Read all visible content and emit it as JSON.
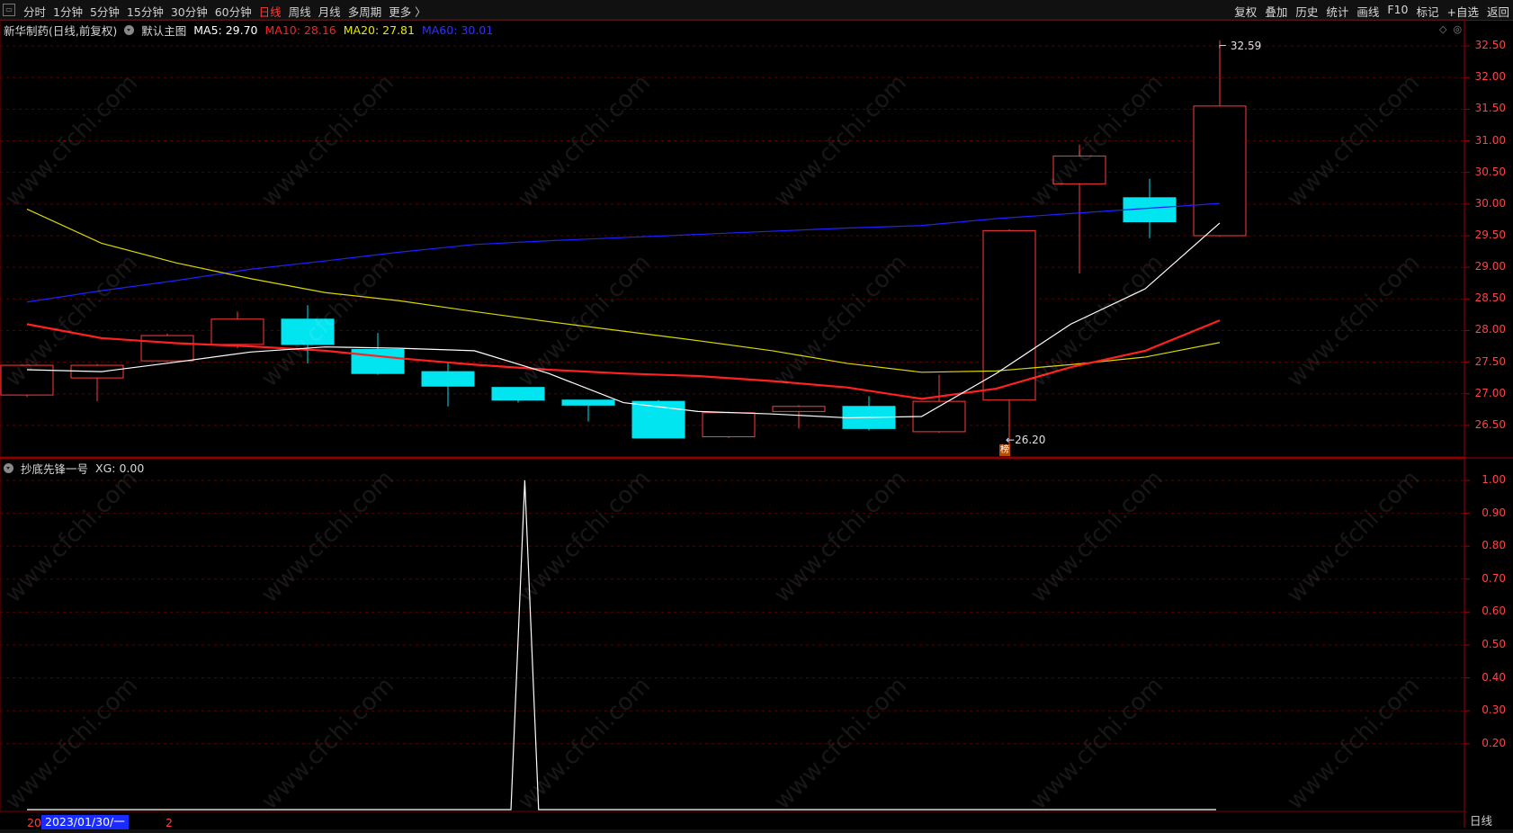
{
  "topbar": {
    "periods": [
      "分时",
      "1分钟",
      "5分钟",
      "15分钟",
      "30分钟",
      "60分钟",
      "日线",
      "周线",
      "月线",
      "多周期",
      "更多 〉"
    ],
    "active_period": "日线",
    "tools": [
      "复权",
      "叠加",
      "历史",
      "统计",
      "画线",
      "F10",
      "标记",
      "+自选",
      "返回"
    ]
  },
  "main_legend": {
    "title": "新华制药(日线,前复权)",
    "indicator": "默认主图",
    "ma5": "MA5: 29.70",
    "ma10": "MA10: 28.16",
    "ma20": "MA20: 27.81",
    "ma60": "MA60: 30.01"
  },
  "sub_legend": {
    "title": "抄底先锋一号",
    "xg": "XG: 0.00"
  },
  "main_axis": [
    "32.50",
    "32.00",
    "31.50",
    "31.00",
    "30.50",
    "30.00",
    "29.50",
    "29.00",
    "28.50",
    "28.00",
    "27.50",
    "27.00",
    "26.50"
  ],
  "sub_axis": [
    "1.00",
    "0.90",
    "0.80",
    "0.70",
    "0.60",
    "0.50",
    "0.40",
    "0.30",
    "0.20"
  ],
  "annotations": {
    "high_label": "32.59",
    "low_label": "26.20",
    "bang": "榜"
  },
  "bottom": {
    "date_prefix": "20",
    "date": "2023/01/30/一",
    "date_suffix": "2",
    "rili": "日线"
  },
  "watermark": "www.cfchi.com",
  "colors": {
    "up": "#ff3b3b",
    "down": "#00e5f0",
    "ma5": "#ffffff",
    "ma10": "#ff2020",
    "ma20": "#d8d800",
    "ma60": "#2020ff"
  },
  "chart_data": {
    "type": "candlestick",
    "candles": [
      {
        "open": 26.98,
        "close": 27.45,
        "high": 27.47,
        "low": 26.95
      },
      {
        "open": 27.25,
        "close": 27.45,
        "high": 27.47,
        "low": 26.88
      },
      {
        "open": 27.52,
        "close": 27.92,
        "high": 27.95,
        "low": 27.5
      },
      {
        "open": 27.78,
        "close": 28.18,
        "high": 28.3,
        "low": 27.72
      },
      {
        "open": 28.18,
        "close": 27.78,
        "high": 28.4,
        "low": 27.48
      },
      {
        "open": 27.7,
        "close": 27.32,
        "high": 27.96,
        "low": 27.3
      },
      {
        "open": 27.35,
        "close": 27.12,
        "high": 27.5,
        "low": 26.8
      },
      {
        "open": 27.1,
        "close": 26.9,
        "high": 27.1,
        "low": 26.86
      },
      {
        "open": 26.9,
        "close": 26.82,
        "high": 26.9,
        "low": 26.56
      },
      {
        "open": 26.88,
        "close": 26.3,
        "high": 26.9,
        "low": 26.3
      },
      {
        "open": 26.32,
        "close": 26.7,
        "high": 26.72,
        "low": 26.3
      },
      {
        "open": 26.72,
        "close": 26.8,
        "high": 26.82,
        "low": 26.45
      },
      {
        "open": 26.8,
        "close": 26.45,
        "high": 26.96,
        "low": 26.42
      },
      {
        "open": 26.4,
        "close": 26.88,
        "high": 27.3,
        "low": 26.38
      },
      {
        "open": 26.9,
        "close": 29.58,
        "high": 29.6,
        "low": 26.2
      },
      {
        "open": 30.32,
        "close": 30.76,
        "high": 30.94,
        "low": 28.9
      },
      {
        "open": 30.1,
        "close": 29.72,
        "high": 30.4,
        "low": 29.46
      },
      {
        "open": 29.5,
        "close": 31.55,
        "high": 32.59,
        "low": 29.48
      }
    ],
    "ma5": [
      27.38,
      27.35,
      27.5,
      27.66,
      27.74,
      27.72,
      27.68,
      27.32,
      26.86,
      26.72,
      26.68,
      26.62,
      26.64,
      27.32,
      28.1,
      28.66,
      29.7
    ],
    "ma10": [
      28.1,
      27.88,
      27.8,
      27.75,
      27.68,
      27.56,
      27.46,
      27.38,
      27.32,
      27.28,
      27.2,
      27.1,
      26.92,
      27.08,
      27.42,
      27.68,
      28.16
    ],
    "ma20": [
      29.92,
      29.38,
      29.07,
      28.82,
      28.6,
      28.47,
      28.3,
      28.14,
      27.99,
      27.84,
      27.68,
      27.48,
      27.34,
      27.36,
      27.46,
      27.58,
      27.81
    ],
    "ma60": [
      28.45,
      28.63,
      28.79,
      28.97,
      29.1,
      29.24,
      29.36,
      29.42,
      29.47,
      29.52,
      29.57,
      29.62,
      29.66,
      29.77,
      29.85,
      29.93,
      30.01
    ],
    "xg": [
      0,
      0,
      0,
      0,
      0,
      0,
      0,
      0,
      0,
      0,
      0,
      0,
      0,
      0,
      0,
      0,
      0,
      0,
      0,
      0,
      0,
      0,
      0,
      0,
      0,
      0,
      0,
      0,
      0,
      0,
      0,
      0,
      0,
      0,
      0,
      0,
      1,
      0,
      0,
      0,
      0,
      0,
      0,
      0,
      0,
      0,
      0,
      0,
      0,
      0,
      0,
      0,
      0,
      0,
      0,
      0,
      0,
      0,
      0,
      0,
      0,
      0,
      0,
      0,
      0,
      0,
      0,
      0,
      0,
      0,
      0,
      0,
      0,
      0,
      0,
      0,
      0,
      0,
      0,
      0,
      0,
      0,
      0,
      0,
      0,
      0,
      0
    ],
    "main_ylim": [
      26.0,
      32.8
    ],
    "sub_ylim": [
      0,
      1.06
    ]
  }
}
